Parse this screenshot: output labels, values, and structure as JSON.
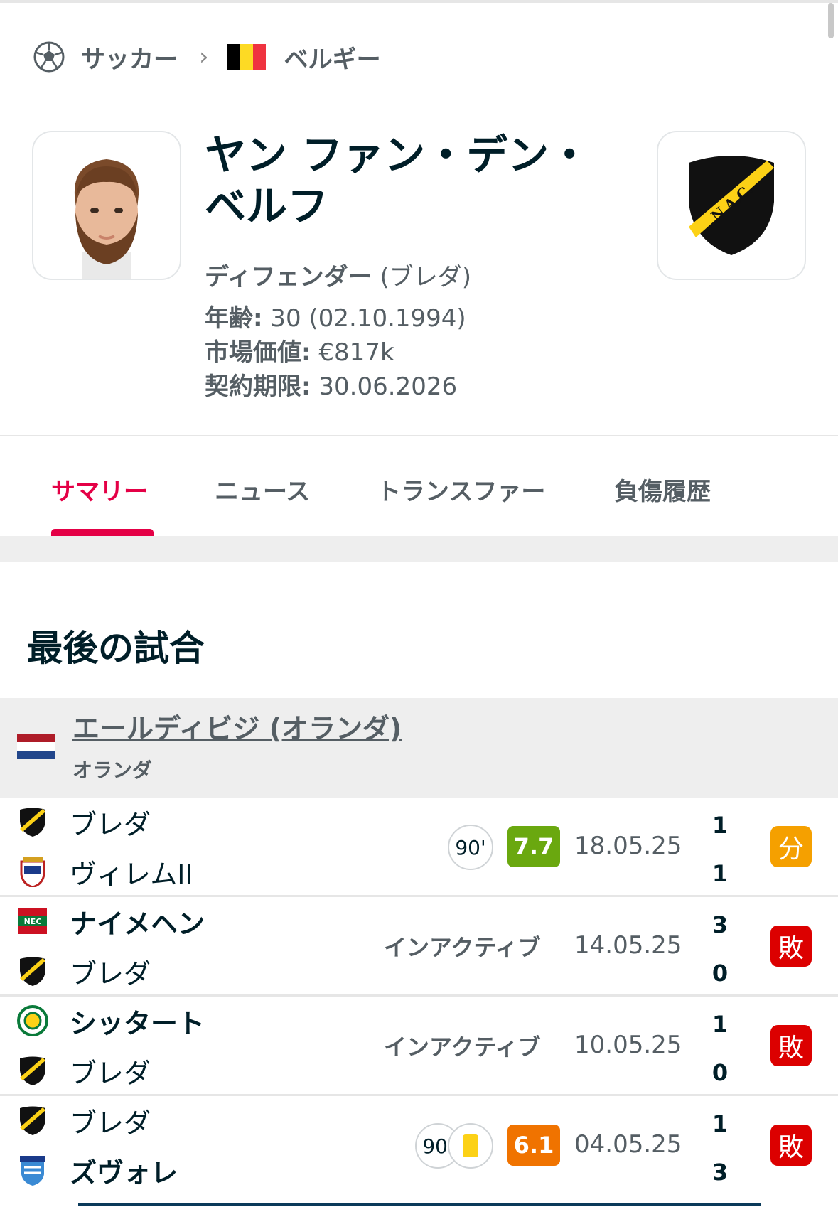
{
  "breadcrumb": {
    "sport": "サッカー",
    "country": "ベルギー"
  },
  "player": {
    "name": "ヤン ファン・デン・ベルフ",
    "position": "ディフェンダー",
    "club_paren": "(ブレダ)",
    "age_label": "年齢:",
    "age_value": "30 (02.10.1994)",
    "market_label": "市場価値:",
    "market_value": "€817k",
    "contract_label": "契約期限:",
    "contract_value": "30.06.2026"
  },
  "tabs": [
    "サマリー",
    "ニュース",
    "トランスファー",
    "負傷履歴"
  ],
  "section_title": "最後の試合",
  "league": {
    "name": "エールディビジ (オランダ)",
    "country": "オランダ"
  },
  "matches": [
    {
      "home": "ブレダ",
      "away": "ヴィレムII",
      "home_score": "1",
      "away_score": "1",
      "date": "18.05.25",
      "minutes": "90'",
      "rating": "7.7",
      "rating_color": "#6aa80f",
      "result": "分",
      "result_color": "#f5a000"
    },
    {
      "home": "ナイメヘン",
      "away": "ブレダ",
      "home_score": "3",
      "away_score": "0",
      "date": "14.05.25",
      "status": "インアクティブ",
      "result": "敗",
      "result_color": "#dc0000"
    },
    {
      "home": "シッタート",
      "away": "ブレダ",
      "home_score": "1",
      "away_score": "0",
      "date": "10.05.25",
      "status": "インアクティブ",
      "result": "敗",
      "result_color": "#dc0000"
    },
    {
      "home": "ブレダ",
      "away": "ズヴォレ",
      "home_score": "1",
      "away_score": "3",
      "date": "04.05.25",
      "minutes": "90'",
      "rating": "6.1",
      "rating_color": "#f07300",
      "result": "敗",
      "result_color": "#dc0000"
    }
  ],
  "colors": {
    "accent": "#e40046",
    "text": "#001e28",
    "muted": "#555e64"
  },
  "icons": [
    "soccer-ball-icon",
    "chevron-right-icon",
    "belgium-flag-icon",
    "netherlands-flag-icon",
    "nac-crest-icon",
    "willem-crest-icon",
    "nec-crest-icon",
    "fortuna-crest-icon",
    "zwolle-crest-icon",
    "yellow-card-icon"
  ]
}
